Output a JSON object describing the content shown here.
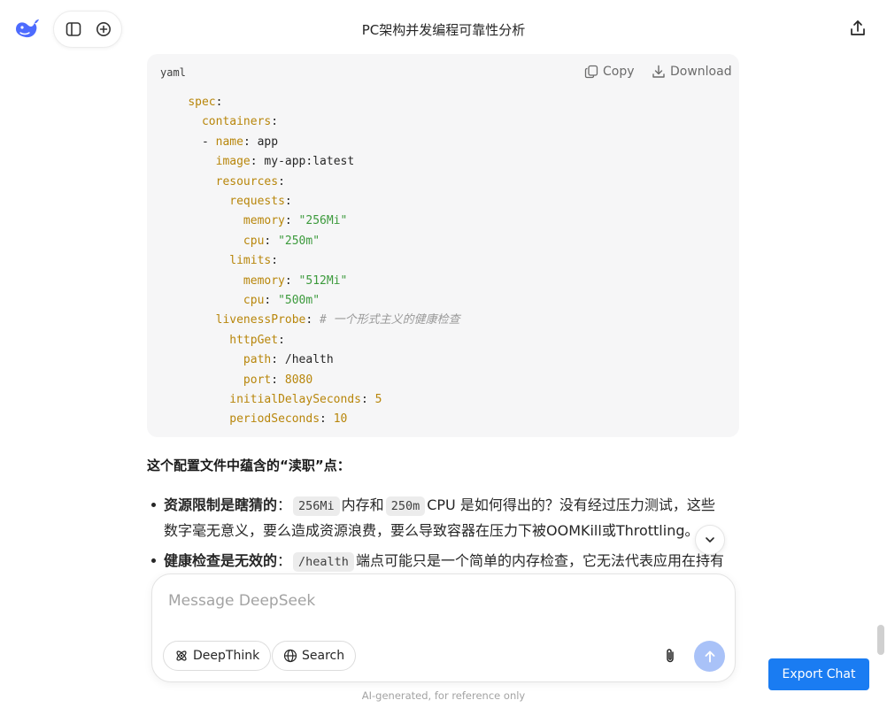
{
  "header": {
    "title": "PC架构并发编程可靠性分析",
    "icons": [
      "deepseek-whale-logo",
      "sidebar-toggle-icon",
      "new-chat-icon",
      "share-icon"
    ]
  },
  "code_block": {
    "language": "yaml",
    "copy_label": "Copy",
    "download_label": "Download",
    "lines": [
      {
        "indent": "    ",
        "key": "spec",
        "sep": ":",
        "value": "",
        "vtype": ""
      },
      {
        "indent": "      ",
        "key": "containers",
        "sep": ":",
        "value": "",
        "vtype": ""
      },
      {
        "indent": "      - ",
        "key": "name",
        "sep": ": ",
        "value": "app",
        "vtype": "p"
      },
      {
        "indent": "        ",
        "key": "image",
        "sep": ": ",
        "value": "my-app:latest",
        "vtype": "p"
      },
      {
        "indent": "        ",
        "key": "resources",
        "sep": ":",
        "value": "",
        "vtype": ""
      },
      {
        "indent": "          ",
        "key": "requests",
        "sep": ":",
        "value": "",
        "vtype": ""
      },
      {
        "indent": "            ",
        "key": "memory",
        "sep": ": ",
        "value": "\"256Mi\"",
        "vtype": "s"
      },
      {
        "indent": "            ",
        "key": "cpu",
        "sep": ": ",
        "value": "\"250m\"",
        "vtype": "s"
      },
      {
        "indent": "          ",
        "key": "limits",
        "sep": ":",
        "value": "",
        "vtype": ""
      },
      {
        "indent": "            ",
        "key": "memory",
        "sep": ": ",
        "value": "\"512Mi\"",
        "vtype": "s"
      },
      {
        "indent": "            ",
        "key": "cpu",
        "sep": ": ",
        "value": "\"500m\"",
        "vtype": "s"
      },
      {
        "indent": "        ",
        "key": "livenessProbe",
        "sep": ": ",
        "value": "# 一个形式主义的健康检查",
        "vtype": "c"
      },
      {
        "indent": "          ",
        "key": "httpGet",
        "sep": ":",
        "value": "",
        "vtype": ""
      },
      {
        "indent": "            ",
        "key": "path",
        "sep": ": ",
        "value": "/health",
        "vtype": "p"
      },
      {
        "indent": "            ",
        "key": "port",
        "sep": ": ",
        "value": "8080",
        "vtype": "n"
      },
      {
        "indent": "          ",
        "key": "initialDelaySeconds",
        "sep": ": ",
        "value": "5",
        "vtype": "n"
      },
      {
        "indent": "          ",
        "key": "periodSeconds",
        "sep": ": ",
        "value": "10",
        "vtype": "n"
      }
    ]
  },
  "answer": {
    "heading": "这个配置文件中蕴含的“渎职”点：",
    "bullets": [
      {
        "bold": "资源限制是瞎猜的",
        "colon": "：",
        "code1": "256Mi",
        "mid1": "内存和",
        "code2": "250m",
        "rest1": "CPU 是如何得出的？没有经过压力测试，这些",
        "line2": "数字毫无意义，要么造成资源浪费，要么导致容器在压力下被OOMKill或Throttling。"
      },
      {
        "bold": "健康检查是无效的",
        "colon": "：",
        "code1": "/health",
        "rest1": "端点可能只是一个简单的内存检查，它无法代表应用在持有"
      }
    ]
  },
  "composer": {
    "placeholder": "Message DeepSeek",
    "deepthink_label": "DeepThink",
    "search_label": "Search",
    "disclaimer": "AI-generated, for reference only"
  },
  "export_label": "Export Chat",
  "colors": {
    "accent": "#1a7cf2",
    "send_disabled": "#a9c2f8",
    "logo": "#4d6bfe",
    "code_key": "#b8860b",
    "code_string": "#3c9a3c"
  }
}
